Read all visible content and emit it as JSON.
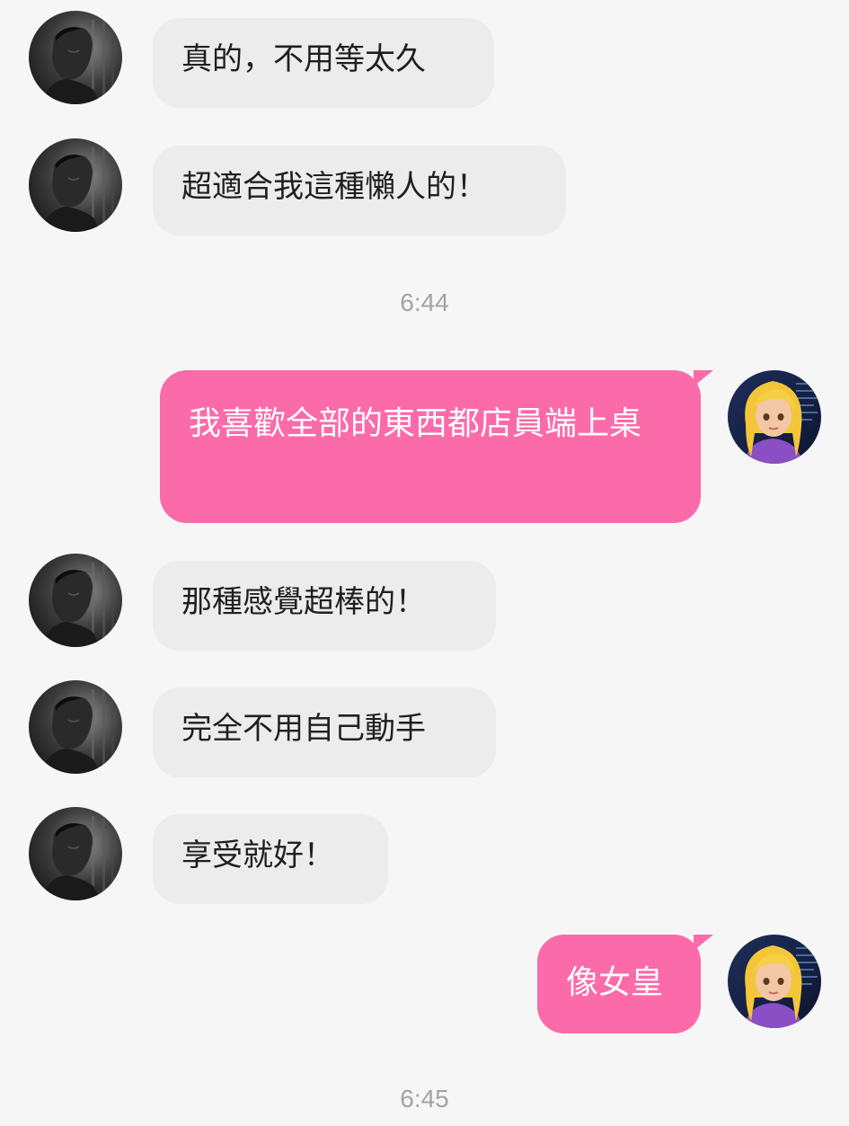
{
  "messages_in": [
    {
      "text": "真的，不用等太久"
    },
    {
      "text": "超適合我這種懶人的！"
    },
    {
      "text": "那種感覺超棒的！"
    },
    {
      "text": "完全不用自己動手"
    },
    {
      "text": "享受就好！"
    }
  ],
  "messages_out": [
    {
      "text": "我喜歡全部的東西都店員端上桌"
    },
    {
      "text": "像女皇"
    }
  ],
  "timestamps": [
    "6:44",
    "6:45"
  ],
  "colors": {
    "background": "#f6f6f6",
    "incoming_bubble": "#ececec",
    "outgoing_bubble": "#fb6aa9",
    "timestamp_text": "#a3a3a3"
  },
  "icons": {
    "contact_avatar": "man-avatar-icon",
    "user_avatar": "girl-avatar-icon"
  }
}
